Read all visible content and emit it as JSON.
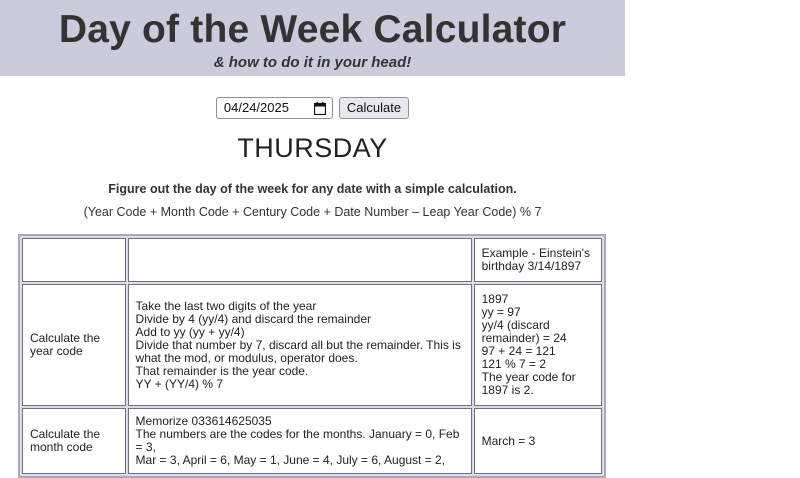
{
  "header": {
    "title": "Day of the Week Calculator",
    "subtitle": "& how to do it in your head!"
  },
  "controls": {
    "date_value": "04/24/2025",
    "calculate_label": "Calculate"
  },
  "result": {
    "day": "THURSDAY"
  },
  "intro": {
    "lead": "Figure out the day of the week for any date with a simple calculation.",
    "formula": "(Year Code + Month Code + Century Code + Date Number – Leap Year Code) % 7"
  },
  "table": {
    "header_example": [
      "Example - Einstein's",
      "birthday 3/14/1897"
    ],
    "rows": [
      {
        "label": [
          "Calculate the",
          "year code"
        ],
        "steps": [
          "Take the last two digits of the year",
          "Divide by 4 (yy/4) and discard the remainder",
          "Add to yy (yy + yy/4)",
          "Divide that number by 7, discard all but the remainder. This is",
          "what the mod, or modulus, operator does.",
          "That remainder is the year code.",
          "YY + (YY/4) % 7"
        ],
        "example": [
          "1897",
          "yy = 97",
          "yy/4 (discard",
          "remainder) = 24",
          "97 + 24 = 121",
          "121 % 7 = 2",
          "The year code for",
          "1897 is 2."
        ]
      },
      {
        "label": [
          "Calculate the",
          "month code"
        ],
        "steps": [
          "Memorize 033614625035",
          "The numbers are the codes for the months. January = 0, Feb = 3,",
          "Mar = 3, April = 6, May = 1, June = 4, July = 6, August = 2,"
        ],
        "example": [
          "March = 3"
        ]
      }
    ]
  }
}
